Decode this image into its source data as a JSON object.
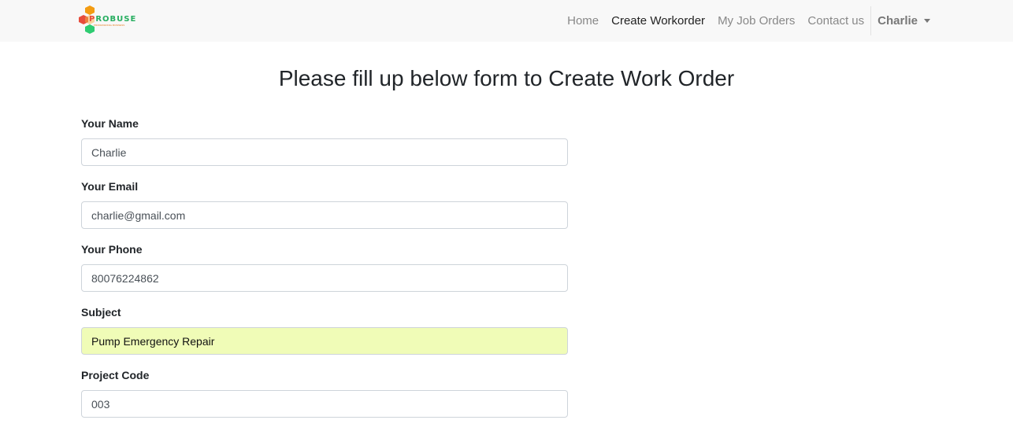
{
  "navbar": {
    "brand": {
      "name_first": "P",
      "name_rest": "ROBUSE",
      "tagline": "PROFESSIONAL BUSINESS"
    },
    "links": [
      {
        "label": "Home",
        "active": false
      },
      {
        "label": "Create Workorder",
        "active": true
      },
      {
        "label": "My Job Orders",
        "active": false
      },
      {
        "label": "Contact us",
        "active": false
      }
    ],
    "user": {
      "label": "Charlie"
    }
  },
  "page": {
    "title": "Please fill up below form to Create Work Order"
  },
  "form": {
    "fields": [
      {
        "label": "Your Name",
        "value": "Charlie",
        "autofill": false
      },
      {
        "label": "Your Email",
        "value": "charlie@gmail.com",
        "autofill": false
      },
      {
        "label": "Your Phone",
        "value": "80076224862",
        "autofill": false
      },
      {
        "label": "Subject",
        "value": "Pump Emergency Repair",
        "autofill": true
      },
      {
        "label": "Project Code",
        "value": "003",
        "autofill": false
      }
    ]
  },
  "colors": {
    "navbar_bg": "#f8f8f8",
    "autofill_bg": "#f0fcb7",
    "logo_orange": "#f39c12",
    "logo_red": "#e74c3c",
    "logo_green": "#2ecc71"
  }
}
